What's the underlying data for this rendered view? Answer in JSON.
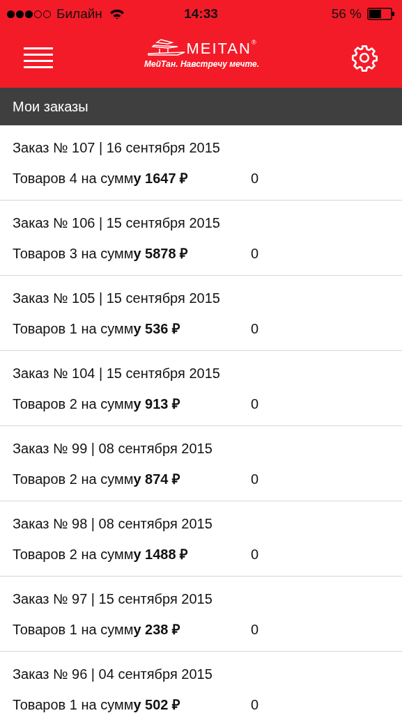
{
  "status_bar": {
    "carrier": "Билайн",
    "time": "14:33",
    "battery": "56 %"
  },
  "header": {
    "logo_wordmark": "MEITAN",
    "logo_mark": "®",
    "tagline": "МейТан. Навстречу мечте."
  },
  "section_title": "Мои заказы",
  "orders": [
    {
      "title": "Заказ № 107 | 16 сентября 2015",
      "summary": "Товаров 4 на сумм**у 1647 ₽**",
      "count": "0"
    },
    {
      "title": "Заказ № 106 | 15 сентября 2015",
      "summary": "Товаров 3 на сумм**у 5878 ₽**",
      "count": "0"
    },
    {
      "title": "Заказ № 105 | 15 сентября 2015",
      "summary": "Товаров 1 на сумм**у 536 ₽**",
      "count": "0"
    },
    {
      "title": "Заказ № 104 | 15 сентября 2015",
      "summary": "Товаров 2 на сумм**у 913 ₽**",
      "count": "0"
    },
    {
      "title": "Заказ № 99 | 08 сентября 2015",
      "summary": "Товаров 2 на сумм**у 874 ₽**",
      "count": "0"
    },
    {
      "title": "Заказ № 98 | 08 сентября 2015",
      "summary": "Товаров 2 на сумм**у 1488 ₽**",
      "count": "0"
    },
    {
      "title": "Заказ № 97 | 15 сентября 2015",
      "summary": "Товаров 1 на сумм**у 238 ₽**",
      "count": "0"
    },
    {
      "title": "Заказ № 96 | 04 сентября 2015",
      "summary": "Товаров 1 на сумм**у 502 ₽**",
      "count": "0"
    }
  ]
}
